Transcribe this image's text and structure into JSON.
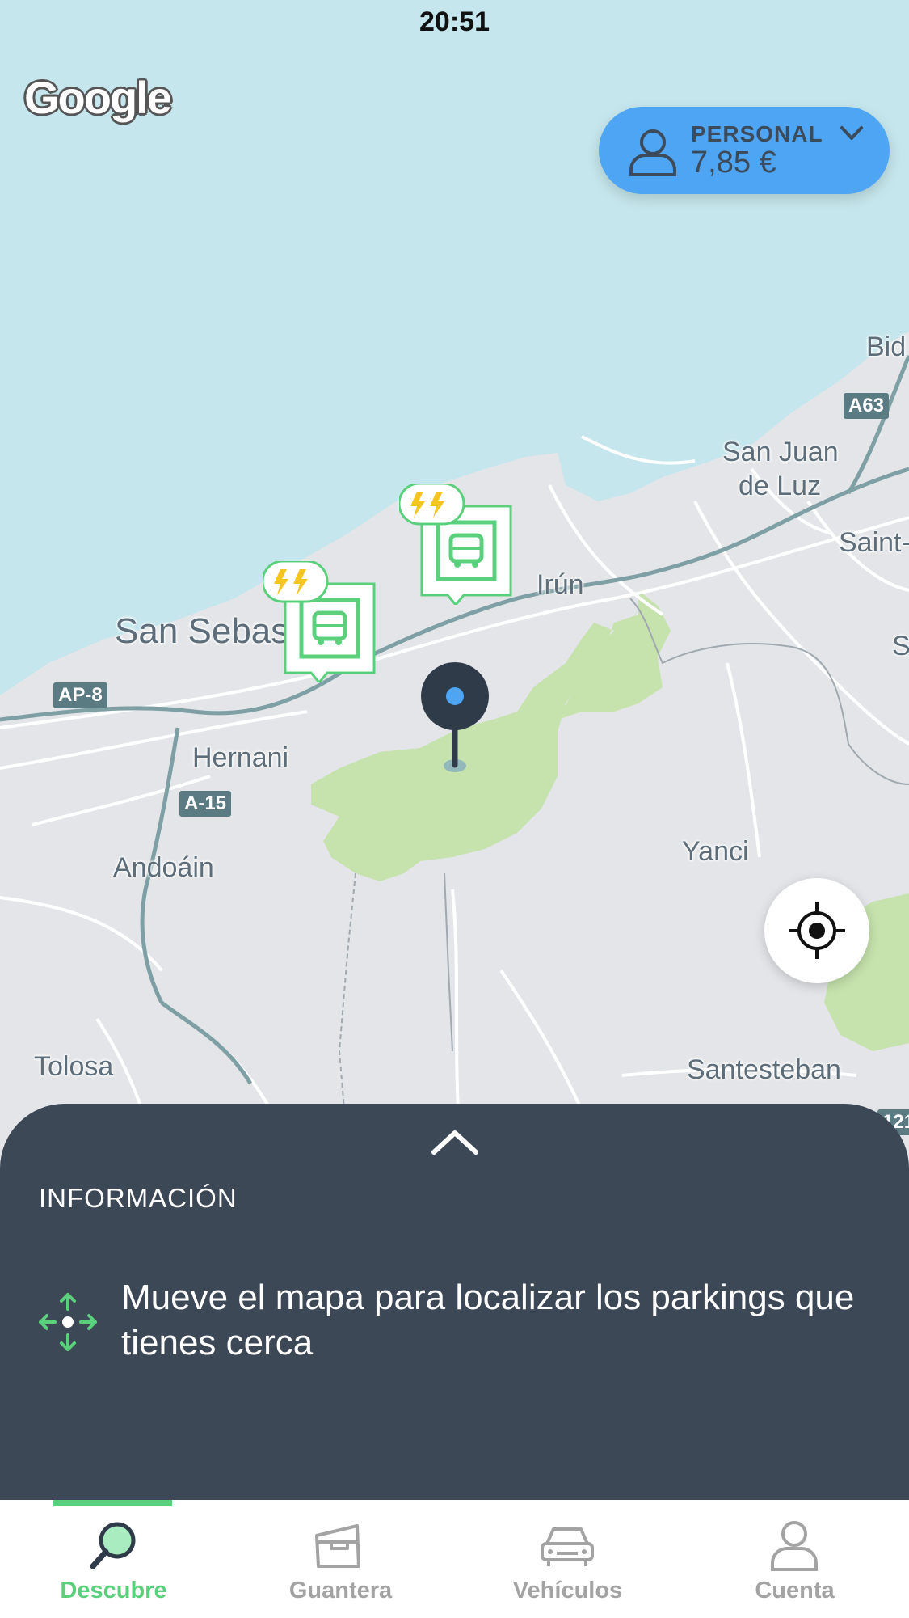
{
  "status_bar": {
    "time": "20:51"
  },
  "map": {
    "provider_logo": "Google",
    "labels": {
      "bidart": "Bid",
      "san_juan_1": "San Juan",
      "san_juan_2": "de Luz",
      "saint": "Saint-",
      "s_edge": "S",
      "irun": "Irún",
      "san_sebastian": "San Sebas",
      "hernani": "Hernani",
      "andoain": "Andoáin",
      "yanci": "Yanci",
      "tolosa": "Tolosa",
      "santesteban": "Santesteban"
    },
    "shields": {
      "ap8": "AP-8",
      "a15": "A-15",
      "a63": "A63",
      "n121": "121"
    },
    "colors": {
      "sea": "#c4e6ec",
      "land": "#e3e5e8",
      "park": "#c6e2ad",
      "road": "#ffffff",
      "highway": "#7ea0a4"
    }
  },
  "profile": {
    "label": "PERSONAL",
    "amount": "7,85 €",
    "icon": "user-icon",
    "accent": "#4ea5f3"
  },
  "markers": [
    {
      "type": "ev-charging-parking",
      "icon": "bus-icon",
      "badge_icon": "lightning-icon"
    },
    {
      "type": "ev-charging-parking",
      "icon": "bus-icon",
      "badge_icon": "lightning-icon"
    }
  ],
  "locate_button": {
    "icon": "crosshair-icon"
  },
  "info_sheet": {
    "title": "INFORMACIÓN",
    "message": "Mueve el mapa para localizar los parkings que tienes cerca",
    "icon": "move-arrows-icon"
  },
  "tabs": [
    {
      "label": "Descubre",
      "icon": "search-icon",
      "active": true
    },
    {
      "label": "Guantera",
      "icon": "glovebox-icon",
      "active": false
    },
    {
      "label": "Vehículos",
      "icon": "car-icon",
      "active": false
    },
    {
      "label": "Cuenta",
      "icon": "user-icon",
      "active": false
    }
  ],
  "theme": {
    "active_tab": "#5bd07c",
    "sheet_bg": "#3d4857"
  }
}
